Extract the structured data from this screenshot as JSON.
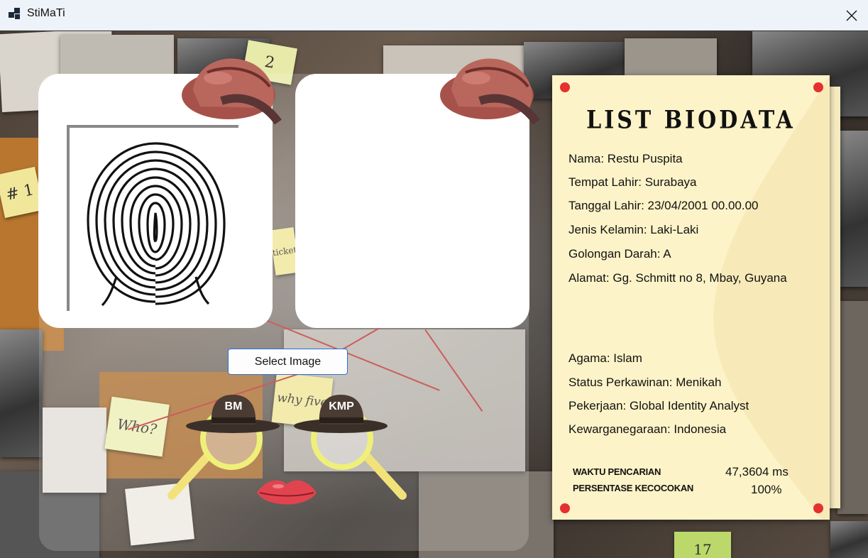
{
  "window": {
    "title": "StiMaTi",
    "close_icon": "close-icon"
  },
  "images": {
    "left_panel": "fingerprint-image",
    "right_panel": "empty-result-image"
  },
  "actions": {
    "select_image_label": "Select Image"
  },
  "mascots": {
    "left_hat": "BM",
    "right_hat": "KMP"
  },
  "background_notes": {
    "note1": "# 1",
    "note2": "Who?",
    "note3": "why five",
    "note4": "ticket",
    "note5": "2",
    "note6": "17"
  },
  "biodata": {
    "title": "LIST BIODATA",
    "nama": "Nama: Restu Puspita",
    "tempat_lahir": "Tempat Lahir: Surabaya",
    "tanggal_lahir": "Tanggal Lahir: 23/04/2001 00.00.00",
    "jenis_kelamin": "Jenis Kelamin: Laki-Laki",
    "golongan_darah": "Golongan Darah: A",
    "alamat": "Alamat: Gg. Schmitt no 8, Mbay, Guyana",
    "agama": "Agama: Islam",
    "status_perkawinan": "Status Perkawinan: Menikah",
    "pekerjaan": "Pekerjaan: Global Identity Analyst",
    "kewarganegaraan": "Kewarganegaraan: Indonesia"
  },
  "stats": {
    "waktu_label": "WAKTU PENCARIAN",
    "waktu_value": "47,3604 ms",
    "persentase_label": "PERSENTASE KECOCOKAN",
    "persentase_value": "100%"
  },
  "colors": {
    "accent_button_border": "#2f6fd6",
    "bio_paper": "#fdf3c8",
    "pin_red": "#e53030"
  }
}
